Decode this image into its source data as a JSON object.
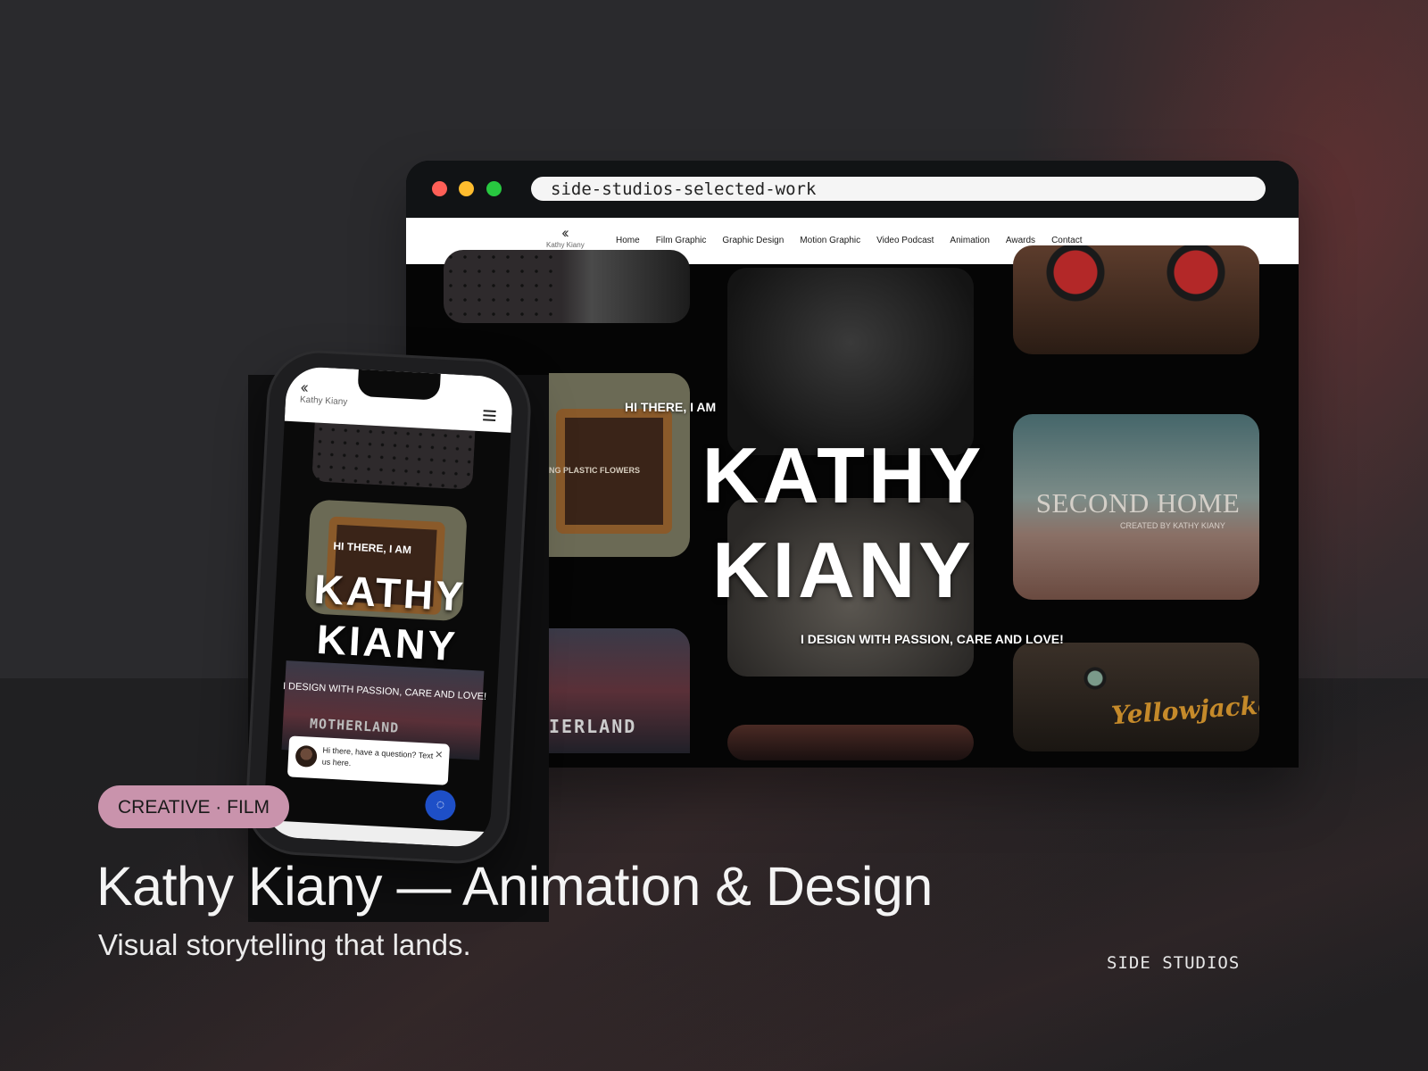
{
  "browser": {
    "url": "side-studios-selected-work"
  },
  "site": {
    "logo_name": "Kathy Kiany",
    "nav": [
      "Home",
      "Film Graphic",
      "Graphic Design",
      "Motion Graphic",
      "Video Podcast",
      "Animation",
      "Awards",
      "Contact"
    ],
    "hero_intro": "HI THERE, I AM",
    "hero_name_line1": "KATHY",
    "hero_name_line2": "KIANY",
    "hero_tagline": "I DESIGN WITH PASSION, CARE AND LOVE!",
    "tiles": {
      "plastic_flowers_label": "NG PLASTIC FLOWERS",
      "second_home_title": "SECOND HOME",
      "second_home_credit": "CREATED BY KATHY KIANY",
      "motherland_label": "IERLAND",
      "yellowjackets_label": "Yellowjackets"
    }
  },
  "phone": {
    "logo_name": "Kathy Kiany",
    "hero_intro": "HI THERE, I AM",
    "hero_name_line1": "KATHY",
    "hero_name_line2": "KIANY",
    "hero_tagline": "I DESIGN WITH PASSION, CARE AND LOVE!",
    "motherland_label": "MOTHERLAND",
    "chat_text": "Hi there, have a question? Text us here."
  },
  "caption": {
    "pill": "CREATIVE · FILM",
    "headline": "Kathy Kiany — Animation & Design",
    "subhead": "Visual storytelling that lands.",
    "brand": "SIDE STUDIOS"
  },
  "colors": {
    "page_bg": "#2a2a2d",
    "pill_bg": "#c993ac",
    "chat_fab": "#1e4fc7"
  }
}
